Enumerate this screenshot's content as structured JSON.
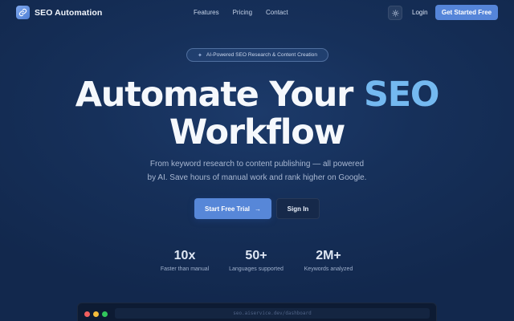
{
  "brand": {
    "name": "SEO Automation",
    "icon": "link-icon"
  },
  "nav": {
    "links": [
      "Features",
      "Pricing",
      "Contact"
    ],
    "login": "Login",
    "cta": "Get Started Free",
    "theme_icon": "sun-icon"
  },
  "badge": {
    "text": "AI-Powered SEO Research & Content Creation"
  },
  "hero": {
    "line1_part1": "Automate Your ",
    "line1_accent": "SEO",
    "line2": "Workflow",
    "subtitle_line1": "From keyword research to content publishing — all powered",
    "subtitle_line2": "by AI. Save hours of manual work and rank higher on Google.",
    "primary_button": "Start Free Trial",
    "secondary_button": "Sign In"
  },
  "stats": [
    {
      "value": "10x",
      "label": "Faster than manual"
    },
    {
      "value": "50+",
      "label": "Languages supported"
    },
    {
      "value": "2M+",
      "label": "Keywords analyzed"
    }
  ],
  "browser": {
    "url": "seo.aiservice.dev/dashboard"
  },
  "colors": {
    "accent": "#74b9f0",
    "primary": "#5787d8",
    "background": "#16305a"
  }
}
